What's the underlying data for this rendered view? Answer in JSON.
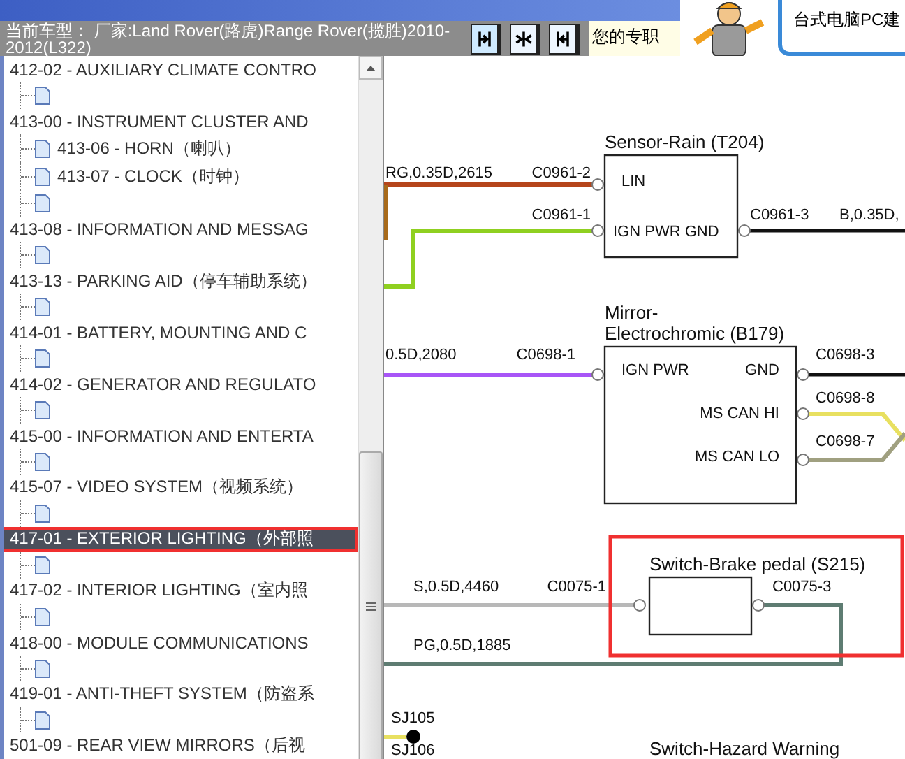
{
  "header": {
    "vehicle_label": "当前车型：",
    "vehicle": "厂家:Land Rover(路虎)Range Rover(揽胜)2010-2012(L322)",
    "notice": "您的专职",
    "ad_text": "台式电脑PC建"
  },
  "tree": [
    {
      "label": "412-02 - AUXILIARY CLIMATE CONTRO",
      "selected": false,
      "highlighted": false,
      "children": [
        {
          "kind": "document"
        }
      ]
    },
    {
      "label": "413-00 - INSTRUMENT CLUSTER AND",
      "selected": false,
      "highlighted": false,
      "children": [
        {
          "kind": "document",
          "label": "413-06 - HORN（喇叭）"
        },
        {
          "kind": "document",
          "label": "413-07 - CLOCK（时钟）"
        },
        {
          "kind": "document"
        }
      ]
    },
    {
      "label": "413-08 - INFORMATION AND MESSAG",
      "selected": false,
      "highlighted": false,
      "children": [
        {
          "kind": "document"
        }
      ]
    },
    {
      "label": "413-13 - PARKING AID（停车辅助系统）",
      "selected": false,
      "highlighted": false,
      "children": [
        {
          "kind": "document"
        }
      ]
    },
    {
      "label": "414-01 - BATTERY, MOUNTING AND C",
      "selected": false,
      "highlighted": false,
      "children": [
        {
          "kind": "document"
        }
      ]
    },
    {
      "label": "414-02 - GENERATOR AND REGULATO",
      "selected": false,
      "highlighted": false,
      "children": [
        {
          "kind": "document"
        }
      ]
    },
    {
      "label": "415-00 - INFORMATION AND ENTERTA",
      "selected": false,
      "highlighted": false,
      "children": [
        {
          "kind": "document"
        }
      ]
    },
    {
      "label": "415-07 - VIDEO SYSTEM（视频系统）",
      "selected": false,
      "highlighted": false,
      "children": [
        {
          "kind": "document"
        }
      ]
    },
    {
      "label": "417-01 - EXTERIOR LIGHTING（外部照",
      "selected": true,
      "highlighted": true,
      "children": [
        {
          "kind": "document"
        }
      ]
    },
    {
      "label": "417-02 - INTERIOR LIGHTING（室内照",
      "selected": false,
      "highlighted": false,
      "children": [
        {
          "kind": "document"
        }
      ]
    },
    {
      "label": "418-00 - MODULE COMMUNICATIONS",
      "selected": false,
      "highlighted": false,
      "children": [
        {
          "kind": "document"
        }
      ]
    },
    {
      "label": "419-01 - ANTI-THEFT SYSTEM（防盗系",
      "selected": false,
      "highlighted": false,
      "children": [
        {
          "kind": "document"
        }
      ]
    },
    {
      "label": "501-09 - REAR VIEW MIRRORS（后视",
      "selected": false,
      "highlighted": false
    }
  ],
  "diagram": {
    "components": [
      {
        "title_lines": [
          "Sensor-Rain (T204)"
        ],
        "pins": [
          "LIN",
          "IGN PWR GND"
        ],
        "highlighted": false
      },
      {
        "title_lines": [
          "Mirror-",
          "Electrochromic (B179)"
        ],
        "pins": [
          "IGN PWR",
          "GND",
          "MS CAN HI",
          "MS CAN LO"
        ],
        "highlighted": false
      },
      {
        "title_lines": [
          "Switch-Brake pedal (S215)"
        ],
        "highlighted": true
      }
    ],
    "connectors": [
      "C0961-2",
      "C0961-1",
      "C0961-3",
      "C0698-1",
      "C0698-3",
      "C0698-8",
      "C0698-7",
      "C0075-1",
      "C0075-3"
    ],
    "wire_labels": [
      "RG,0.35D,2615",
      "B,0.35D,",
      "0.5D,2080",
      "S,0.5D,4460",
      "PG,0.5D,1885"
    ],
    "splices": [
      "SJ105",
      "SJ106"
    ],
    "next_component": "Switch-Hazard Warning"
  }
}
